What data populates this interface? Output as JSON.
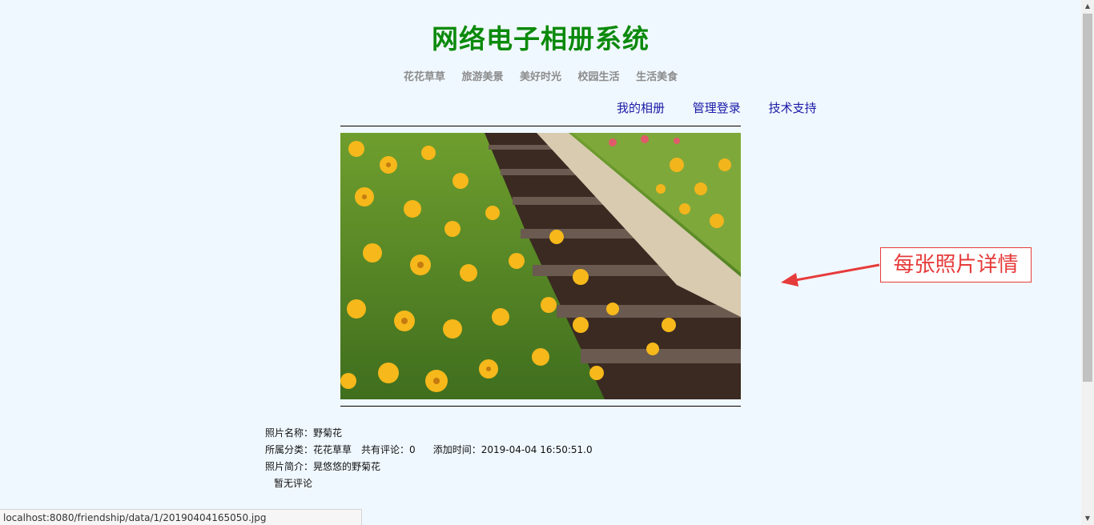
{
  "header": {
    "title": "网络电子相册系统",
    "categories": [
      "花花草草",
      "旅游美景",
      "美好时光",
      "校园生活",
      "生活美食"
    ],
    "links": [
      "我的相册",
      "管理登录",
      "技术支持"
    ]
  },
  "photo_detail": {
    "name_label": "照片名称：",
    "name": "野菊花",
    "category_label": "所属分类：",
    "category": "花花草草",
    "comments_label": "共有评论：",
    "comments_count": "0",
    "added_label": "添加时间：",
    "added_time": "2019-04-04 16:50:51.0",
    "intro_label": "照片简介：",
    "intro": "晃悠悠的野菊花",
    "no_comments": "暂无评论"
  },
  "annotation": {
    "text": "每张照片详情",
    "color": "#e63b3b"
  },
  "status_bar": {
    "url": "localhost:8080/friendship/data/1/20190404165050.jpg"
  },
  "colors": {
    "title": "#0b8a0b",
    "link": "#1a1aa6",
    "background": "#f0f8ff"
  }
}
